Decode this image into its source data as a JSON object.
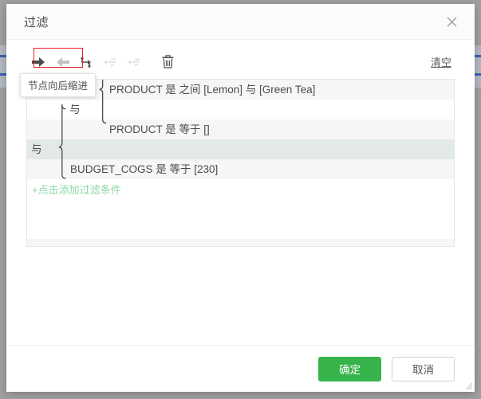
{
  "dialog": {
    "title": "过滤",
    "close_icon": "close-icon"
  },
  "toolbar": {
    "buttons": [
      {
        "name": "indent-node-button",
        "icon": "arrow-right-icon",
        "disabled": false
      },
      {
        "name": "outdent-node-button",
        "icon": "arrow-left-icon",
        "disabled": false
      },
      {
        "name": "branch-node-button",
        "icon": "arrow-turn-down-icon",
        "disabled": false
      },
      {
        "name": "move-up-button",
        "icon": "tree-move-up-icon",
        "disabled": true
      },
      {
        "name": "move-down-button",
        "icon": "tree-move-down-icon",
        "disabled": true
      },
      {
        "name": "delete-node-button",
        "icon": "trash-icon",
        "disabled": false
      }
    ],
    "clear_label": "清空",
    "highlight_color": "#ec1c24"
  },
  "tooltip": {
    "text": "节点向后缩进"
  },
  "conditions": {
    "rows": [
      {
        "text": "PRODUCT 是 之间 [Lemon] 与 [Green Tea]",
        "indent": 2,
        "style": "shade",
        "kind": "condition"
      },
      {
        "text": "与",
        "indent": 1,
        "style": "plain",
        "kind": "operator"
      },
      {
        "text": "PRODUCT 是 等于 []",
        "indent": 2,
        "style": "shade",
        "kind": "condition"
      },
      {
        "text": "与",
        "indent": 0,
        "style": "active",
        "kind": "operator"
      },
      {
        "text": "BUDGET_COGS 是 等于 [230]",
        "indent": 1,
        "style": "shade",
        "kind": "condition"
      }
    ],
    "add_label": "+点击添加过滤条件",
    "add_color": "#8fd6a6",
    "empty_rows": [
      "plain",
      "plain",
      "shade",
      "plain"
    ]
  },
  "footer": {
    "confirm_label": "确定",
    "cancel_label": "取消",
    "confirm_color": "#36b44b"
  }
}
